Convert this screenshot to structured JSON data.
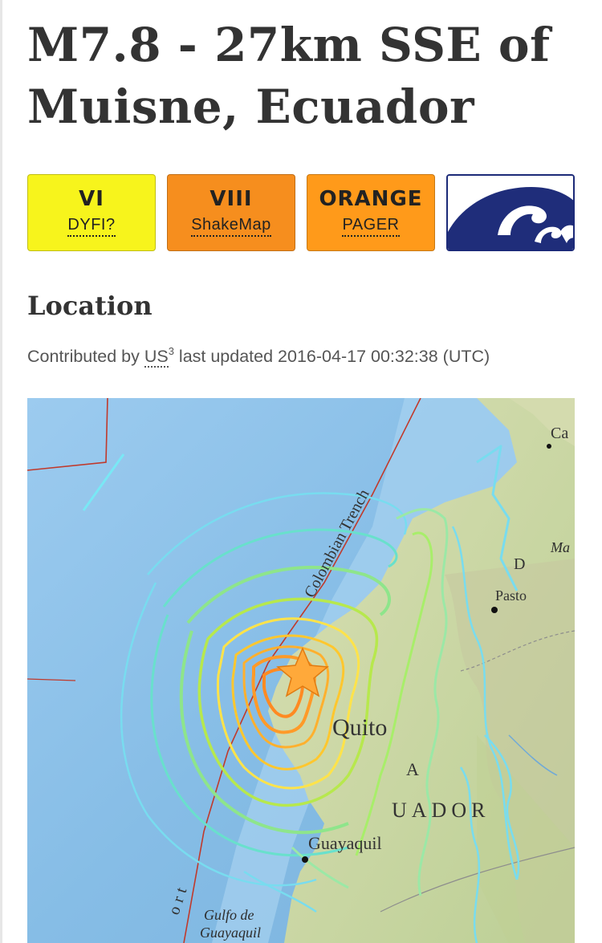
{
  "event": {
    "title": "M7.8 - 27km SSE of Muisne, Ecuador"
  },
  "impact_badges": [
    {
      "value": "VI",
      "label": "DYFI?",
      "color": "#f7f41c"
    },
    {
      "value": "VIII",
      "label": "ShakeMap",
      "color": "#f68e1e"
    },
    {
      "value": "ORANGE",
      "label": "PAGER",
      "color": "#ff9a1a"
    }
  ],
  "tsunami_icon": "tsunami-wave-icon",
  "location": {
    "heading": "Location",
    "contributed_prefix": "Contributed by",
    "network": "US",
    "network_sup": "3",
    "updated_text": "last updated 2016-04-17 00:32:38 (UTC)"
  },
  "map": {
    "labels": {
      "trench": "Colombian Trench",
      "quito": "Quito",
      "pasto": "Pasto",
      "ecuador": "UADOR",
      "guayaquil": "Guayaquil",
      "gulf_line1": "Gulfo de",
      "gulf_line2": "Guayaquil",
      "edge_top": "Ca",
      "edge_right": "Ma",
      "d_letter": "D",
      "a_letter": "A",
      "trench_lower": "ort"
    },
    "epicenter_icon": "epicenter-star-icon",
    "colors": {
      "ocean": "#8fc3e8",
      "land": "#c9d6a4",
      "plate_boundary": "#c0392b"
    }
  }
}
